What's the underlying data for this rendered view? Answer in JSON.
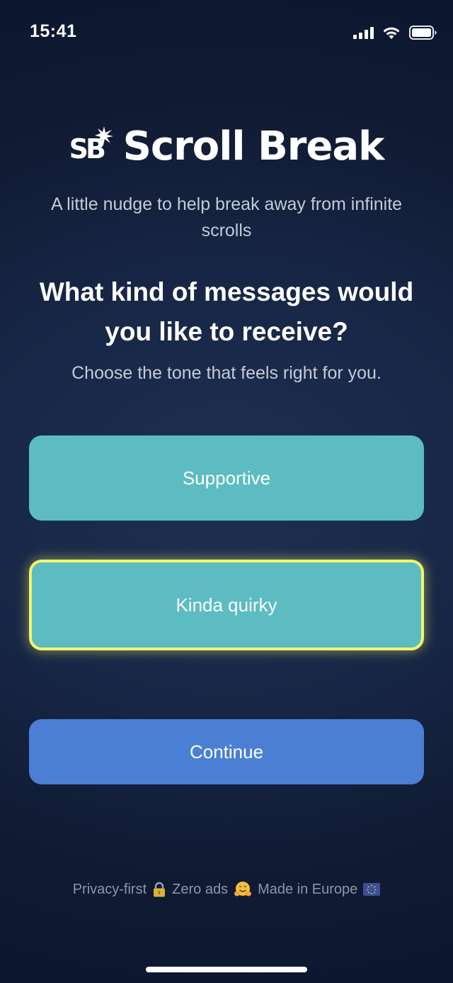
{
  "status_bar": {
    "time": "15:41"
  },
  "header": {
    "logo_text": "SB",
    "title": "Scroll Break",
    "tagline": "A little nudge to help break away from infinite scrolls"
  },
  "prompt": {
    "question": "What kind of messages would you like to receive?",
    "subtitle": "Choose the tone that feels right for you."
  },
  "options": [
    {
      "label": "Supportive",
      "selected": false
    },
    {
      "label": "Kinda quirky",
      "selected": true
    }
  ],
  "continue_label": "Continue",
  "footer": {
    "items": [
      "Privacy-first",
      "Zero ads",
      "Made in Europe"
    ],
    "icons": [
      "lock-icon",
      "hugging-face-icon",
      "eu-flag-icon"
    ]
  },
  "colors": {
    "option_bg": "#5cbcc2",
    "selected_border": "#f3f46a",
    "continue_bg": "#4a7fd3",
    "background": "#14213f"
  }
}
